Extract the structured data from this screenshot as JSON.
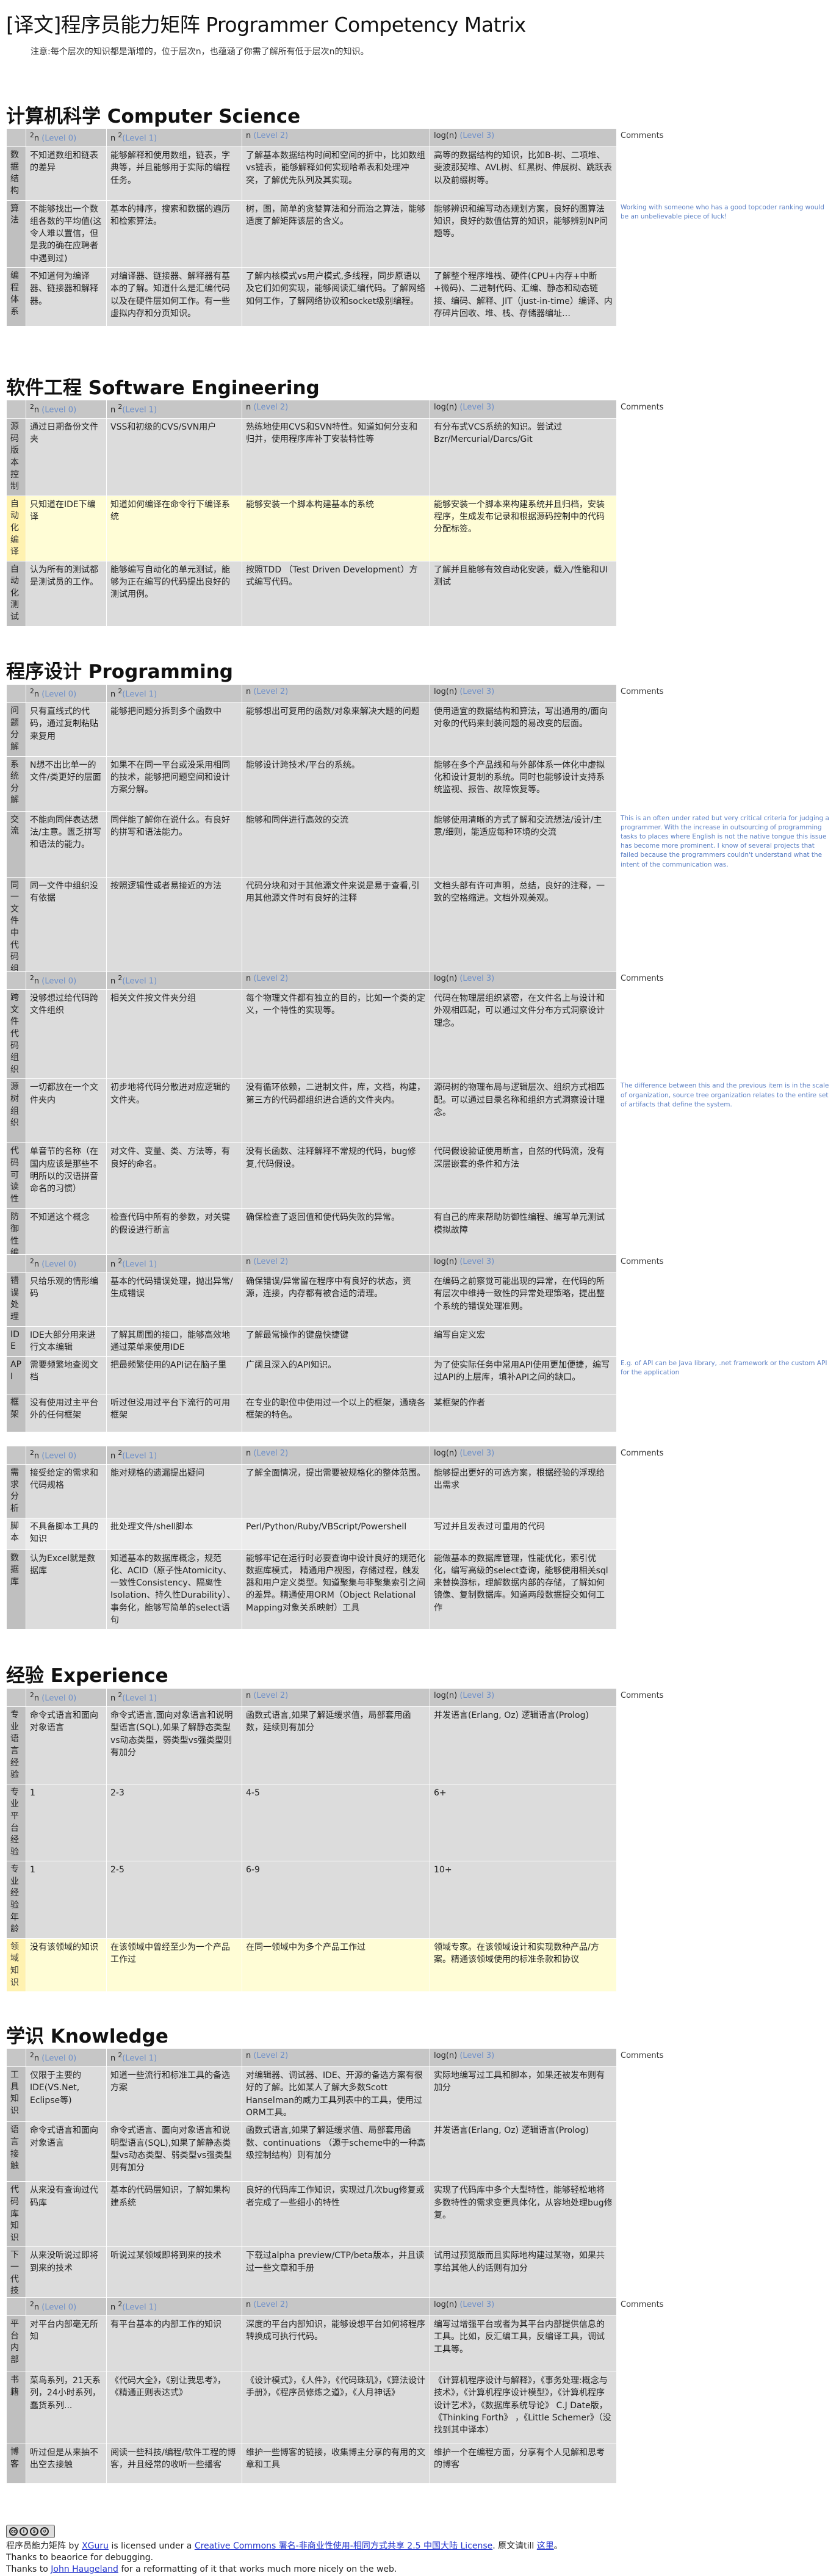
{
  "title": "[译文]程序员能力矩阵 Programmer Competency Matrix",
  "note": "注意:每个层次的知识都是渐增的，位于层次n，也蕴涵了你需了解所有低于层次n的知识。",
  "levels": {
    "l0": "2",
    "l0n": "n",
    "l0r": "(Level 0)",
    "l1": "n",
    "l1s": "2",
    "l1r": "(Level 1)",
    "l2": "n (Level 2)",
    "l2t": "n",
    "l2r": "(Level 2)",
    "l3": "log(n)",
    "l3r": "(Level 3)",
    "comments": "Comments"
  },
  "sections": [
    {
      "title": "计算机科学 Computer Science",
      "rows": [
        {
          "label": "数据结构",
          "cells": [
            "不知道数组和链表的差异",
            "能够解释和使用数组，链表，字典等，并且能够用于实际的编程任务。",
            "了解基本数据结构时间和空间的折中，比如数组vs链表，能够解释如何实现哈希表和处理冲突，了解优先队列及其实现。",
            "高等的数据结构的知识，比如B-树、二项堆、斐波那契堆、AVL树、红黑树、伸展树、跳跃表以及前缀树等。"
          ],
          "comment": ""
        },
        {
          "label": "算法",
          "cells": [
            "不能够找出一个数组各数的平均值(这令人难以置信，但是我的确在应聘者中遇到过)",
            "基本的排序，搜索和数据的遍历和检索算法。",
            "树，图，简单的贪婪算法和分而治之算法，能够适度了解矩阵该层的含义。",
            "能够辨识和编写动态规划方案，良好的图算法知识，良好的数值估算的知识，能够辨别NP问题等。"
          ],
          "comment": "Working with someone who has a good topcoder ranking would be an unbelievable piece of luck!"
        },
        {
          "label": "编程体系",
          "cells": [
            "不知道何为编译器、链接器和解释器。",
            "对编译器、链接器、解释器有基本的了解。知道什么是汇编代码以及在硬件层如何工作。有一些虚拟内存和分页知识。",
            "了解内核模式vs用户模式,多线程，同步原语以及它们如何实现，能够阅读汇编代码。了解网络如何工作，了解网络协议和socket级别编程。",
            "了解整个程序堆栈、硬件(CPU+内存+中断+微码)、二进制代码、汇编、静态和动态链接、编码、解释、JIT（just-in-time）编译、内存碎片回收、堆、栈、存储器编址…"
          ],
          "comment": ""
        }
      ]
    },
    {
      "title": "软件工程 Software Engineering",
      "rows": [
        {
          "label": "源码版本控制",
          "cells": [
            "通过日期备份文件夹",
            "VSS和初级的CVS/SVN用户",
            "熟练地使用CVS和SVN特性。知道如何分支和归并，使用程序库补丁安装特性等",
            "有分布式VCS系统的知识。尝试过Bzr/Mercurial/Darcs/Git"
          ],
          "comment": ""
        },
        {
          "label": "自动化编译",
          "cells": [
            "只知道在IDE下编译",
            "知道如何编译在命令行下编译系统",
            "能够安装一个脚本构建基本的系统",
            "能够安装一个脚本来构建系统并且归档，安装程序，生成发布记录和根据源码控制中的代码分配标签。"
          ],
          "comment": "",
          "hl": true
        },
        {
          "label": "自动化测试",
          "cells": [
            "认为所有的测试都是测试员的工作。",
            "能够编写自动化的单元测试，能够为正在编写的代码提出良好的测试用例。",
            "按照TDD （Test Driven Development）方式编写代码。",
            "了解并且能够有效自动化安装，载入/性能和UI测试"
          ],
          "comment": ""
        }
      ]
    },
    {
      "title": "程序设计 Programming",
      "rows": [
        {
          "label": "问题分解",
          "cells": [
            "只有直线式的代码，通过复制粘贴来复用",
            "能够把问题分拆到多个函数中",
            "能够想出可复用的函数/对象来解决大题的问题",
            "使用适宜的数据结构和算法，写出通用的/面向对象的代码来封装问题的易改变的层面。"
          ],
          "comment": ""
        },
        {
          "label": "系统分解",
          "cells": [
            "N想不出比单一的文件/类更好的层面",
            "如果不在同一平台或没采用相同的技术，能够把问题空间和设计方案分解。",
            "能够设计跨技术/平台的系统。",
            "能够在多个产品线和与外部体系一体化中虚拟化和设计复制的系统。同时也能够设计支持系统监视、报告、故障恢复等。"
          ],
          "comment": ""
        },
        {
          "label": "交流",
          "cells": [
            "不能向同伴表达想法/主意。匮乏拼写和语法的能力。",
            "同伴能了解你在说什么。有良好的拼写和语法能力。",
            "能够和同伴进行高效的交流",
            "能够使用清晰的方式了解和交流想法/设计/主意/细则，能适应每种环境的交流"
          ],
          "comment": "This is an often under rated but very critical criteria for judging a programmer. With the increase in outsourcing of programming tasks to places where English is not the native tongue this issue has become more prominent. I know of several projects that failed because the programmers couldn't understand what the intent of the communication was."
        },
        {
          "label": "同一文件中代码组织",
          "cells": [
            "同一文件中组织没有依据",
            "按照逻辑性或者易接近的方法",
            "代码分块和对于其他源文件来说是易于查看,引用其他源文件时有良好的注释",
            "文档头部有许可声明，总结，良好的注释，一致的空格缩进。文档外观美观。"
          ],
          "comment": ""
        }
      ]
    },
    {
      "title": "",
      "rows": [
        {
          "label": "跨文件代码组织",
          "cells": [
            "没够想过给代码跨文件组织",
            "相关文件按文件夹分组",
            "每个物理文件都有独立的目的，比如一个类的定义，一个特性的实现等。",
            "代码在物理层组织紧密，在文件名上与设计和外观相匹配，可以通过文件分布方式洞察设计理念。"
          ],
          "comment": ""
        },
        {
          "label": "源树组织",
          "cells": [
            "一切都放在一个文件夹内",
            "初步地将代码分散进对应逻辑的文件夹。",
            "没有循环依赖，二进制文件，库，文档，构建，第三方的代码都组织进合适的文件夹内。",
            "源码树的物理布局与逻辑层次、组织方式相匹配。可以通过目录名称和组织方式洞察设计理念。"
          ],
          "comment": "The difference between this and the previous item is in the scale of organization, source tree organization relates to the entire set of artifacts that define the system."
        },
        {
          "label": "代码可读性",
          "cells": [
            "单音节的名称（在国内应该是那些不明所以的汉语拼音命名的习惯）",
            "对文件、变量、类、方法等，有良好的命名。",
            "没有长函数、注释解释不常规的代码，bug修复,代码假设。",
            "代码假设验证使用断言，自然的代码流，没有深层嵌套的条件和方法"
          ],
          "comment": ""
        },
        {
          "label": "防御性编码",
          "cells": [
            "不知道这个概念",
            "检查代码中所有的参数，对关键的假设进行断言",
            "确保检查了返回值和使代码失败的异常。",
            "有自己的库来帮助防御性编程、编写单元测试模拟故障"
          ],
          "comment": ""
        }
      ]
    },
    {
      "title": "",
      "rows": [
        {
          "label": "错误处理",
          "cells": [
            "只给乐观的情形编码",
            "基本的代码错误处理，抛出异常/生成错误",
            "确保错误/异常留在程序中有良好的状态，资源，连接，内存都有被合适的清理。",
            "在编码之前察觉可能出现的异常，在代码的所有层次中维持一致性的异常处理策略，提出整个系统的错误处理准则。"
          ],
          "comment": ""
        },
        {
          "label": "IDE",
          "cells": [
            "IDE大部分用来进行文本编辑",
            "了解其周围的接口，能够高效地通过菜单来使用IDE",
            "了解最常操作的键盘快捷键",
            "编写自定义宏"
          ],
          "comment": ""
        },
        {
          "label": "API",
          "cells": [
            "需要频繁地查阅文档",
            "把最频繁使用的API记在脑子里",
            "广阔且深入的API知识。",
            "为了使实际任务中常用API使用更加便捷，编写过API的上层库，填补API之间的缺口。"
          ],
          "comment": "E.g. of API can be Java library, .net framework or the custom API for the application"
        },
        {
          "label": "框架",
          "cells": [
            "没有使用过主平台外的任何框架",
            "听过但没用过平台下流行的可用框架",
            "在专业的职位中使用过一个以上的框架，通晓各框架的特色。",
            "某框架的作者"
          ],
          "comment": ""
        }
      ]
    },
    {
      "title": "",
      "rows": [
        {
          "label": "需求分析",
          "cells": [
            "接受给定的需求和代码规格",
            "能对规格的遗漏提出疑问",
            "了解全面情况，提出需要被规格化的整体范围。",
            "能够提出更好的可选方案，根据经验的浮现给出需求"
          ],
          "comment": ""
        },
        {
          "label": "脚本",
          "cells": [
            "不具备脚本工具的知识",
            "批处理文件/shell脚本",
            "Perl/Python/Ruby/VBScript/Powershell",
            "写过并且发表过可重用的代码"
          ],
          "comment": "",
          "lite": true
        },
        {
          "label": "数据库",
          "cells": [
            "认为Excel就是数据库",
            "知道基本的数据库概念，规范化、ACID（原子性Atomicity、一致性Consistency、隔离性Isolation、持久性Durability）、事务化，能够写简单的select语句",
            "能够牢记在运行时必要查询中设计良好的规范化数据库模式， 精通用户视图，存储过程，触发器和用户定义类型。知道聚集与非聚集索引之间的差异。精通使用ORM（Object Relational Mapping对象关系映射）工具",
            "能做基本的数据库管理，性能优化，索引优化，编写高级的select查询，能够使用相关sql来替换游标，理解数据内部的存储，了解如何镜像、复制数据库。知道两段数据提交如何工作"
          ],
          "comment": ""
        }
      ]
    },
    {
      "title": "经验 Experience",
      "rows": [
        {
          "label": "专业语言经验",
          "cells": [
            "命令式语言和面向对象语言",
            "命令式语言,面向对象语言和说明型语言(SQL),如果了解静态类型vs动态类型，弱类型vs强类型则有加分",
            "函数式语言,如果了解延缓求值，局部套用函数，延续则有加分",
            "并发语言(Erlang, Oz) 逻辑语言(Prolog)"
          ],
          "comment": ""
        },
        {
          "label": "专业平台经验",
          "cells": [
            "1",
            "2-3",
            "4-5",
            "6+"
          ],
          "comment": ""
        },
        {
          "label": "专业经验年龄",
          "cells": [
            "1",
            "2-5",
            "6-9",
            "10+"
          ],
          "comment": ""
        },
        {
          "label": "领域知识",
          "cells": [
            "没有该领域的知识",
            "在该领域中曾经至少为一个产品工作过",
            "在同一领域中为多个产品工作过",
            "领域专家。在该领域设计和实现数种产品/方案。精通该领域使用的标准条款和协议"
          ],
          "comment": "",
          "hl": true
        }
      ]
    },
    {
      "title": "学识 Knowledge",
      "rows": [
        {
          "label": "工具知识",
          "cells": [
            "仅限于主要的IDE(VS.Net, Eclipse等)",
            "知道一些流行和标准工具的备选方案",
            "对编辑器、调试器、IDE、开源的备选方案有很好的了解。比如某人了解大多数Scott Hanselman的威力工具列表中的工具，使用过ORM工具。",
            "实际地编写过工具和脚本，如果还被发布则有加分"
          ],
          "comment": ""
        },
        {
          "label": "语言接触",
          "cells": [
            "命令式语言和面向对象语言",
            "命令式语言、面向对象语言和说明型语言(SQL),如果了解静态类型vs动态类型、弱类型vs强类型则有加分",
            "函数式语言,如果了解延缓求值、局部套用函数、continuations （源于scheme中的一种高级控制结构）则有加分",
            "并发语言(Erlang, Oz) 逻辑语言(Prolog)"
          ],
          "comment": ""
        },
        {
          "label": "代码库知识",
          "cells": [
            "从来没有查询过代码库",
            "基本的代码层知识，了解如果构建系统",
            "良好的代码库工作知识，实现过几次bug修复或者完成了一些细小的特性",
            "实现了代码库中多个大型特性，能够轻松地将多数特性的需求变更具体化，从容地处理bug修复。"
          ],
          "comment": ""
        },
        {
          "label": "下一代技术知识",
          "cells": [
            "从来没听说过即将到来的技术",
            "听说过某领域即将到来的技术",
            "下载过alpha preview/CTP/beta版本，并且读过一些文章和手册",
            "试用过预览版而且实际地构建过某物，如果共享给其他人的话则有加分"
          ],
          "comment": ""
        }
      ]
    },
    {
      "title": "",
      "rows": [
        {
          "label": "平台内部",
          "cells": [
            "对平台内部毫无所知",
            "有平台基本的内部工作的知识",
            "深度的平台内部知识，能够设想平台如何将程序转换成可执行代码。",
            "编写过增强平台或者为其平台内部提供信息的工具。比如，反汇编工具，反编译工具，调试工具等。"
          ],
          "comment": ""
        },
        {
          "label": "书籍",
          "cells": [
            "菜鸟系列，21天系列，24小时系列，蠢货系列...",
            "《代码大全》，《别让我思考》，《精通正则表达式》",
            "《设计模式》，《人件》，《代码珠玑》，《算法设计手册》，《程序员修炼之道》，《人月神话》",
            "《计算机程序设计与解释》，《事务处理:概念与技术》，《计算机程序设计模型》，《计算机程序设计艺术》，《数据库系统导论》 C.J Date版，《Thinking Forth》 ，《Little Schemer》（没找到其中译本）"
          ],
          "comment": ""
        },
        {
          "label": "博客",
          "cells": [
            "听过但是从来抽不出空去接触",
            "阅读一些科技/编程/软件工程的博客，并且经常的收听一些播客",
            "维护一些博客的链接，收集博主分享的有用的文章和工具",
            "维护一个在编程方面，分享有个人见解和思考的博客"
          ],
          "comment": ""
        }
      ]
    }
  ],
  "footer": {
    "cc_label": "cc by nc sa",
    "line1_prefix": "程序员能力矩阵 by",
    "line1_author": "XGuru",
    "line1_mid": "is licensed under a",
    "line1_license": "Creative Commons 署名-非商业性使用-相同方式共享 2.5 中国大陆 License",
    "line1_suffix": ". 原文请till",
    "line1_here": "这里",
    "line1_end": "。",
    "line2": "Thanks to beaorice for debugging.",
    "line3_prefix": "Thanks to",
    "line3_name": "John Haugeland",
    "line3_suffix": "for a reformatting of it that works much more nicely on the web."
  }
}
